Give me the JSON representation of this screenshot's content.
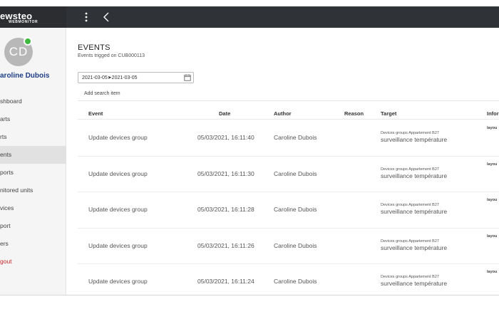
{
  "app": {
    "logo_main": "ewsteo",
    "logo_sub": "WEBMONITOR"
  },
  "user": {
    "initials": "CD",
    "name": "aroline Dubois"
  },
  "sidebar": {
    "items": [
      {
        "label": "shboard",
        "active": false
      },
      {
        "label": "arts",
        "active": false
      },
      {
        "label": "rts",
        "active": false
      },
      {
        "label": "ents",
        "active": true
      },
      {
        "label": "ports",
        "active": false
      },
      {
        "label": "nitored units",
        "active": false
      },
      {
        "label": "vices",
        "active": false
      },
      {
        "label": "port",
        "active": false
      },
      {
        "label": "ers",
        "active": false
      },
      {
        "label": "gout",
        "active": false
      }
    ]
  },
  "page": {
    "title": "EVENTS",
    "subtitle": "Events trigged on CUB000113"
  },
  "filters": {
    "date_range": "2021-03-05➤2021-03-05",
    "search_label": "Add search item"
  },
  "table": {
    "headers": {
      "event": "Event",
      "date": "Date",
      "author": "Author",
      "reason": "Reason",
      "target": "Target",
      "info": "Infor"
    },
    "rows": [
      {
        "event": "Update devices group",
        "date": "05/03/2021, 16:11:40",
        "author": "Caroline Dubois",
        "reason": "",
        "target_small": "Devices groups Appartement B27",
        "target_big": "surveillance température",
        "info": "layou"
      },
      {
        "event": "Update devices group",
        "date": "05/03/2021, 16:11:30",
        "author": "Caroline Dubois",
        "reason": "",
        "target_small": "Devices groups Appartement B27",
        "target_big": "surveillance température",
        "info": "layou"
      },
      {
        "event": "Update devices group",
        "date": "05/03/2021, 16:11:28",
        "author": "Caroline Dubois",
        "reason": "",
        "target_small": "Devices groups Appartement B27",
        "target_big": "surveillance température",
        "info": "layou"
      },
      {
        "event": "Update devices group",
        "date": "05/03/2021, 16:11:26",
        "author": "Caroline Dubois",
        "reason": "",
        "target_small": "Devices groups Appartement B27",
        "target_big": "surveillance température",
        "info": "layou"
      },
      {
        "event": "Update devices group",
        "date": "05/03/2021, 16:11:24",
        "author": "Caroline Dubois",
        "reason": "",
        "target_small": "Devices groups Appartement B27",
        "target_big": "surveillance température",
        "info": "layou"
      }
    ]
  },
  "colors": {
    "topbar": "#2f3236",
    "username": "#1f3e86",
    "logout": "#c62828",
    "status_online": "#3dba3d",
    "active_nav": "#e1e1e1"
  },
  "icons": {
    "menu": "vertical-dots-icon",
    "back": "chevron-left-icon",
    "calendar": "calendar-icon"
  }
}
